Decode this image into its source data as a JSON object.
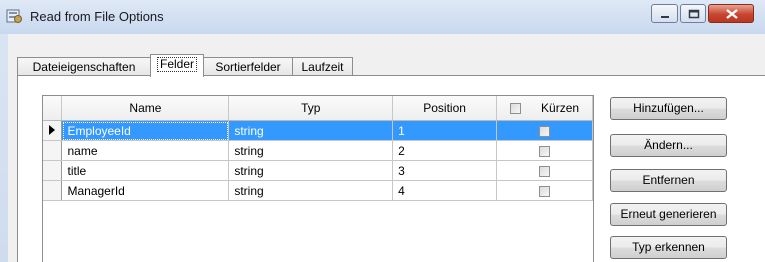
{
  "window": {
    "title": "Read from File Options"
  },
  "tabs": [
    {
      "label": "Dateieigenschaften"
    },
    {
      "label": "Felder"
    },
    {
      "label": "Sortierfelder"
    },
    {
      "label": "Laufzeit"
    }
  ],
  "grid": {
    "columns": {
      "name": "Name",
      "type": "Typ",
      "position": "Position",
      "trim": "Kürzen"
    },
    "rows": [
      {
        "name": "EmployeeId",
        "type": "string",
        "position": "1",
        "selected": true
      },
      {
        "name": "name",
        "type": "string",
        "position": "2"
      },
      {
        "name": "title",
        "type": "string",
        "position": "3"
      },
      {
        "name": "ManagerId",
        "type": "string",
        "position": "4"
      }
    ]
  },
  "buttons": {
    "add": "Hinzufügen...",
    "edit": "Ändern...",
    "remove": "Entfernen",
    "regenerate": "Erneut generieren",
    "detect_type": "Typ erkennen"
  },
  "colors": {
    "selection": "#3399ff",
    "close_button": "#c9452f"
  },
  "icons": {
    "app": "read-file-app-icon",
    "row_indicator": "row-pointer-icon"
  }
}
